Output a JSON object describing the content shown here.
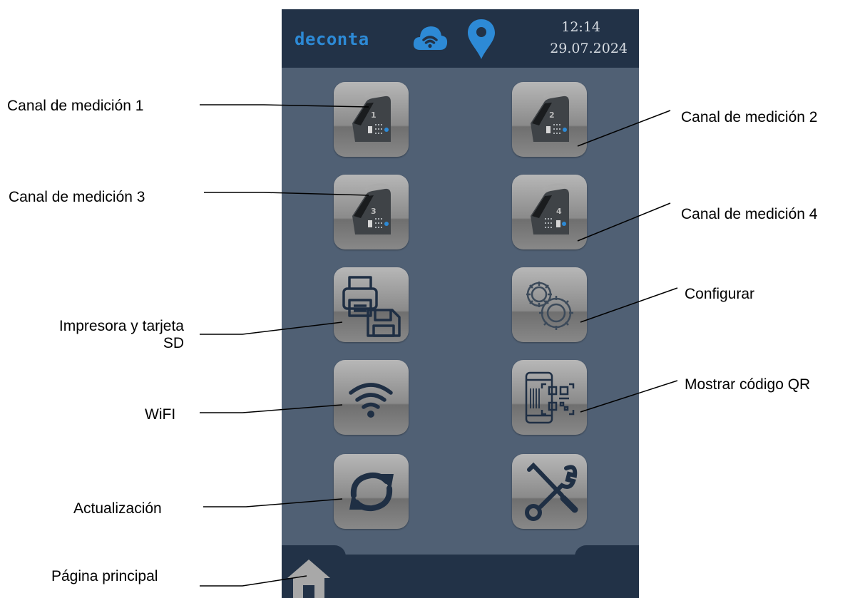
{
  "header": {
    "brand": "deconta",
    "time": "12:14",
    "date": "29.07.2024"
  },
  "colors": {
    "panel_bg": "#506074",
    "header_bg": "#223247",
    "accent": "#2d8ad6"
  },
  "icons": {
    "cloud": "cloud-wifi-icon",
    "location": "location-pin-icon",
    "home": "home-icon"
  },
  "buttons": [
    {
      "name": "measurement-channel-1-button",
      "icon": "device-1-icon",
      "channel": "1"
    },
    {
      "name": "measurement-channel-2-button",
      "icon": "device-2-icon",
      "channel": "2"
    },
    {
      "name": "measurement-channel-3-button",
      "icon": "device-3-icon",
      "channel": "3"
    },
    {
      "name": "measurement-channel-4-button",
      "icon": "device-4-icon",
      "channel": "4"
    },
    {
      "name": "printer-sd-button",
      "icon": "printer-floppy-icon"
    },
    {
      "name": "settings-button",
      "icon": "gears-icon"
    },
    {
      "name": "wifi-button",
      "icon": "wifi-icon"
    },
    {
      "name": "qr-code-button",
      "icon": "phone-qr-icon"
    },
    {
      "name": "update-button",
      "icon": "refresh-icon"
    },
    {
      "name": "tools-button",
      "icon": "tools-icon"
    }
  ],
  "annotations": {
    "channel_1": "Canal de medición 1",
    "channel_2": "Canal de medición 2",
    "channel_3": "Canal de medición 3",
    "channel_4": "Canal de medición 4",
    "printer_line1": "Impresora y tarjeta",
    "printer_line2": "SD",
    "configure": "Configurar",
    "wifi": "WiFI",
    "qr": "Mostrar código QR",
    "update": "Actualización",
    "home": "Página principal"
  }
}
